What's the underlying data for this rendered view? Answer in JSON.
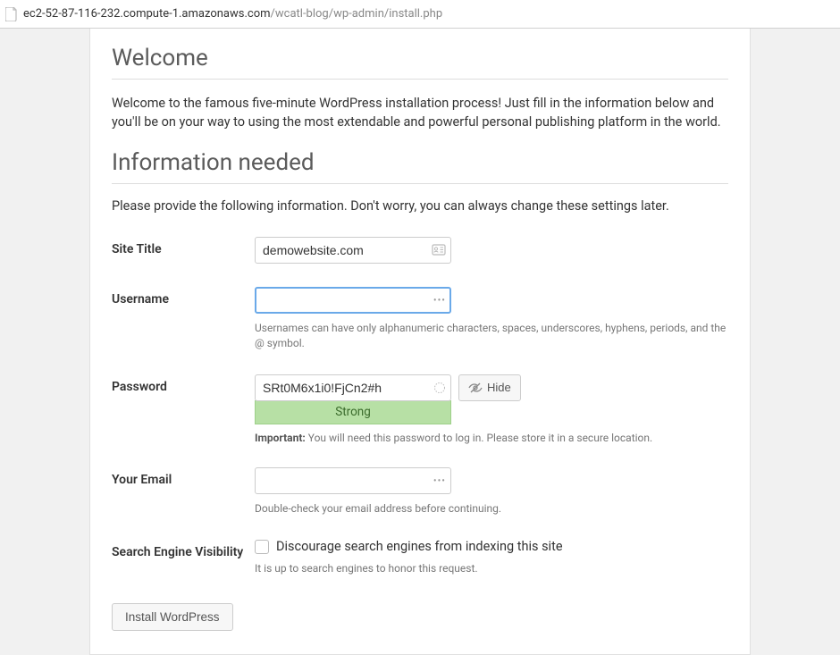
{
  "url_host": "ec2-52-87-116-232.compute-1.amazonaws.com",
  "url_path": "/wcatl-blog/wp-admin/install.php",
  "welcome_heading": "Welcome",
  "welcome_text": "Welcome to the famous five-minute WordPress installation process! Just fill in the information below and you'll be on your way to using the most extendable and powerful personal publishing platform in the world.",
  "info_heading": "Information needed",
  "info_text": "Please provide the following information. Don't worry, you can always change these settings later.",
  "site_title": {
    "label": "Site Title",
    "value": "demowebsite.com"
  },
  "username": {
    "label": "Username",
    "value": "",
    "help": "Usernames can have only alphanumeric characters, spaces, underscores, hyphens, periods, and the @ symbol."
  },
  "password": {
    "label": "Password",
    "value": "SRt0M6x1i0!FjCn2#h",
    "hide_label": "Hide",
    "strength": "Strong",
    "important_label": "Important:",
    "important_text": " You will need this password to log in. Please store it in a secure location."
  },
  "email": {
    "label": "Your Email",
    "value": "",
    "help": "Double-check your email address before continuing."
  },
  "visibility": {
    "label": "Search Engine Visibility",
    "checkbox_label": "Discourage search engines from indexing this site",
    "help": "It is up to search engines to honor this request."
  },
  "submit_label": "Install WordPress"
}
